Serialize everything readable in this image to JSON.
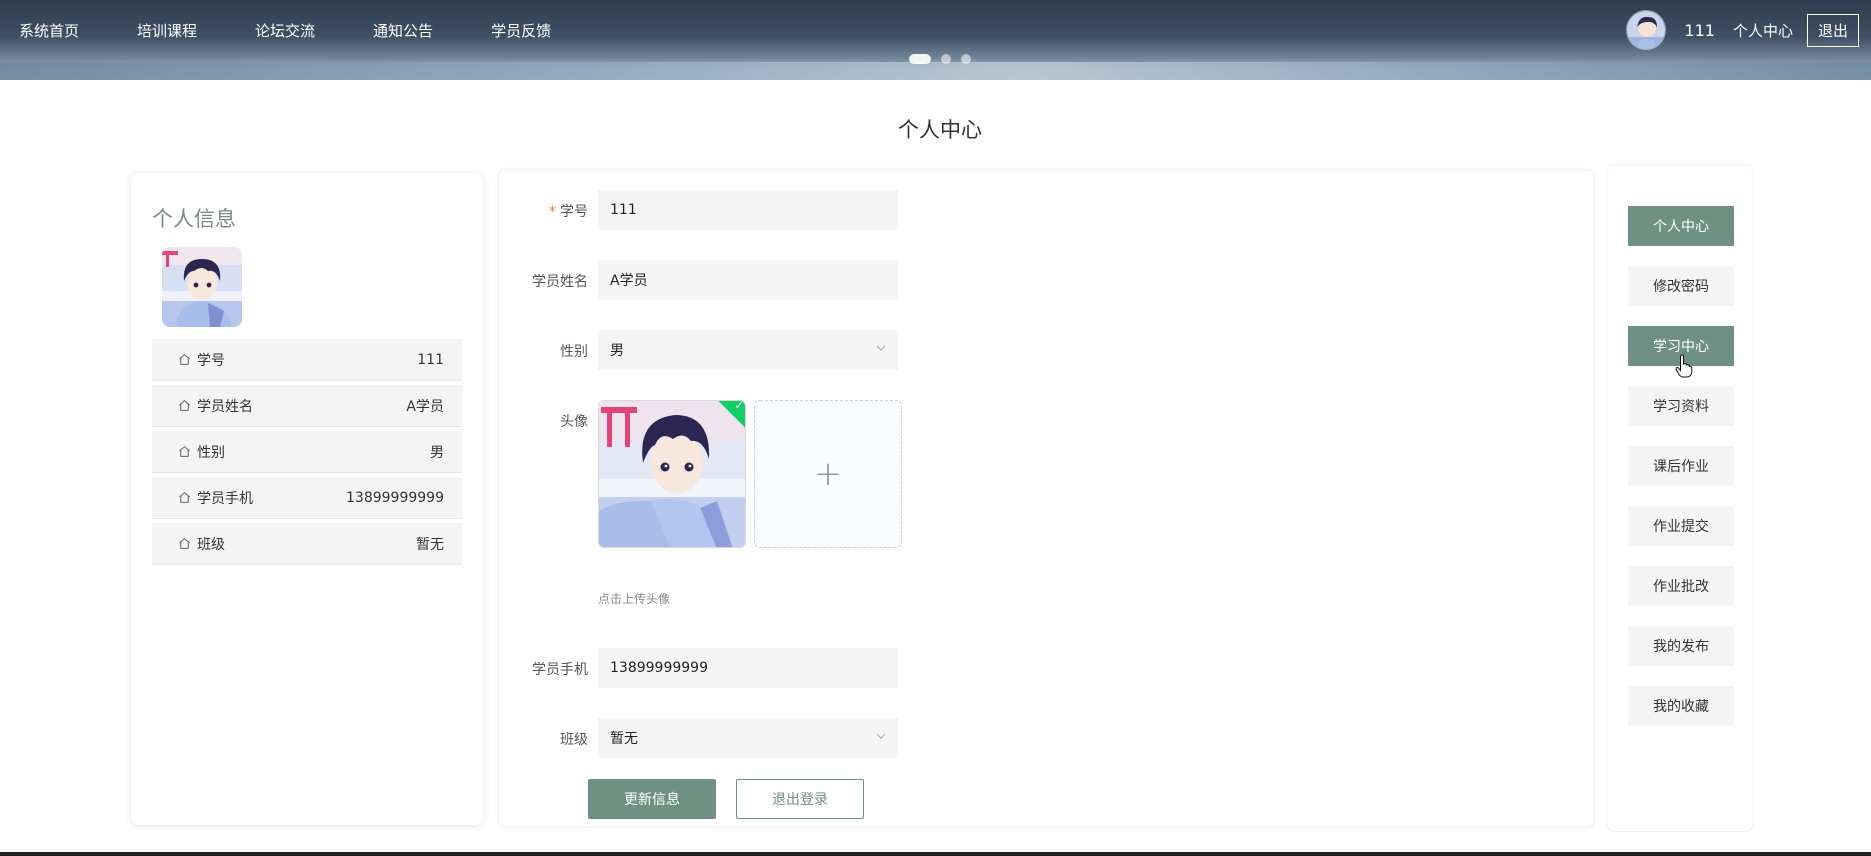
{
  "nav": {
    "items": [
      {
        "label": "系统首页"
      },
      {
        "label": "培训课程"
      },
      {
        "label": "论坛交流"
      },
      {
        "label": "通知公告"
      },
      {
        "label": "学员反馈"
      }
    ]
  },
  "user": {
    "name": "111",
    "center_label": "个人中心",
    "logout_label": "退出"
  },
  "page_title": "个人中心",
  "info_card": {
    "title": "个人信息",
    "rows": [
      {
        "label": "学号",
        "value": "111"
      },
      {
        "label": "学员姓名",
        "value": "A学员"
      },
      {
        "label": "性别",
        "value": "男"
      },
      {
        "label": "学员手机",
        "value": "13899999999"
      },
      {
        "label": "班级",
        "value": "暂无"
      }
    ]
  },
  "form": {
    "student_id": {
      "label": "学号",
      "required_mark": "*",
      "value": "111"
    },
    "name": {
      "label": "学员姓名",
      "value": "A学员"
    },
    "gender": {
      "label": "性别",
      "value": "男"
    },
    "avatar": {
      "label": "头像",
      "tip": "点击上传头像",
      "add_symbol": "+"
    },
    "phone": {
      "label": "学员手机",
      "value": "13899999999"
    },
    "class": {
      "label": "班级",
      "value": "暂无"
    },
    "update_button": "更新信息",
    "logout_button": "退出登录"
  },
  "menu": {
    "items": [
      {
        "label": "个人中心",
        "active": true
      },
      {
        "label": "修改密码",
        "active": false
      },
      {
        "label": "学习中心",
        "active": true
      },
      {
        "label": "学习资料",
        "active": false
      },
      {
        "label": "课后作业",
        "active": false
      },
      {
        "label": "作业提交",
        "active": false
      },
      {
        "label": "作业批改",
        "active": false
      },
      {
        "label": "我的发布",
        "active": false
      },
      {
        "label": "我的收藏",
        "active": false
      }
    ]
  },
  "colors": {
    "accent": "#6f9183",
    "upload_success": "#13ce66"
  }
}
